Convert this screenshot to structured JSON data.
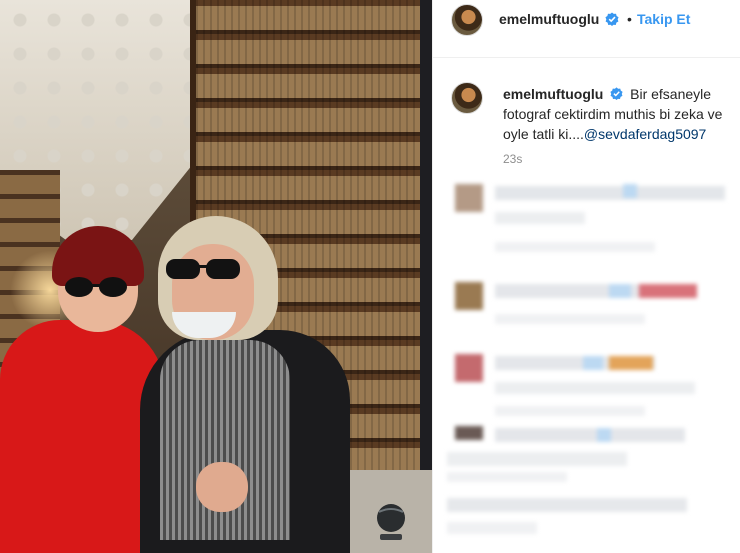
{
  "post": {
    "username": "emelmuftuoglu",
    "follow_label": "Takip Et",
    "separator": "•",
    "caption": {
      "username": "emelmuftuoglu",
      "text": "Bir efsaneyle fotograf cektirdim muthis bi zeka ve oyle tatli ki....",
      "mention": "@sevdaferdag5097"
    },
    "time_ago": "23s"
  },
  "colors": {
    "link_blue": "#3897f0",
    "mention_blue": "#00376b",
    "text": "#262626",
    "muted": "#8e8e8e",
    "verified_blue": "#3897f0"
  },
  "icons": {
    "verified": "verified-badge-icon",
    "globe": "globe-icon"
  }
}
